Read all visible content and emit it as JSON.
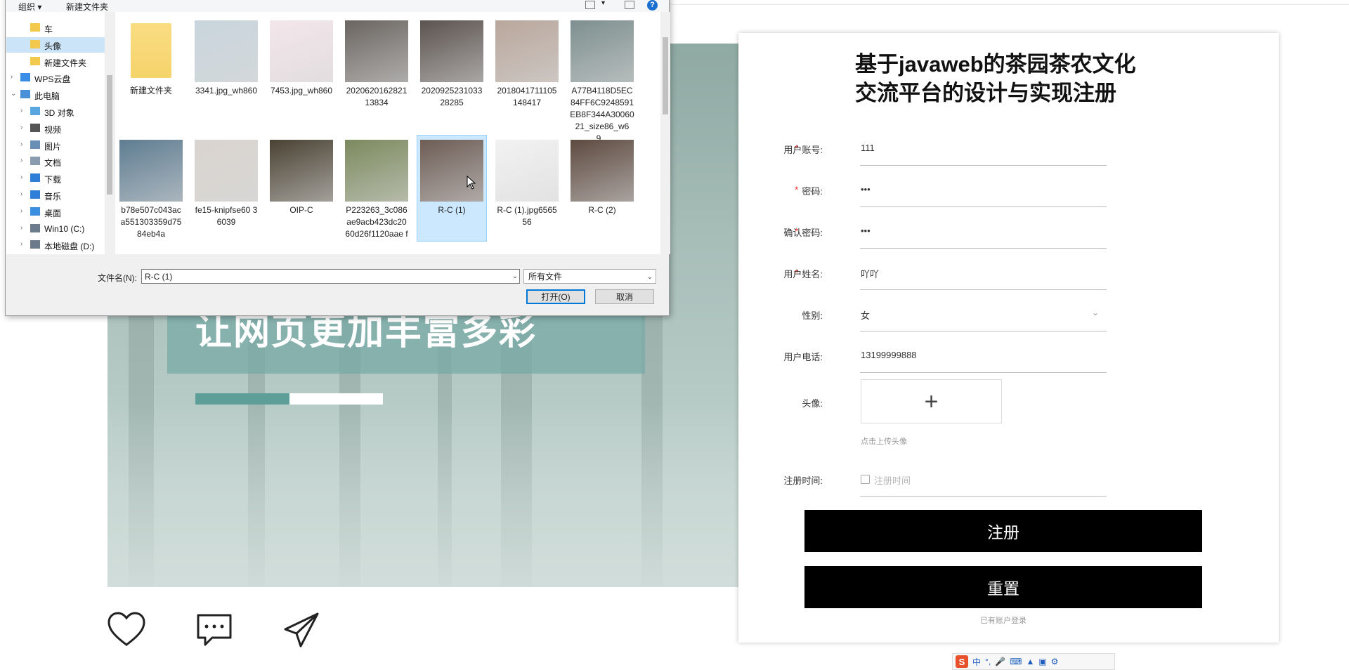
{
  "dialog": {
    "toolbar": {
      "organize": "组织 ▾",
      "new_folder": "新建文件夹"
    },
    "nav": [
      {
        "label": "车",
        "icon": "folder-icon",
        "indent": 1,
        "selected": false
      },
      {
        "label": "头像",
        "icon": "folder-icon",
        "indent": 1,
        "selected": true
      },
      {
        "label": "新建文件夹",
        "icon": "folder-icon",
        "indent": 1,
        "selected": false
      },
      {
        "label": "WPS云盘",
        "icon": "cloud-icon",
        "indent": 0,
        "selected": false
      },
      {
        "label": "此电脑",
        "icon": "computer-icon",
        "indent": 0,
        "selected": false
      },
      {
        "label": "3D 对象",
        "icon": "cube-icon",
        "indent": 1,
        "selected": false
      },
      {
        "label": "视频",
        "icon": "video-icon",
        "indent": 1,
        "selected": false
      },
      {
        "label": "图片",
        "icon": "picture-icon",
        "indent": 1,
        "selected": false
      },
      {
        "label": "文档",
        "icon": "document-icon",
        "indent": 1,
        "selected": false
      },
      {
        "label": "下载",
        "icon": "download-icon",
        "indent": 1,
        "selected": false
      },
      {
        "label": "音乐",
        "icon": "music-icon",
        "indent": 1,
        "selected": false
      },
      {
        "label": "桌面",
        "icon": "desktop-icon",
        "indent": 1,
        "selected": false
      },
      {
        "label": "Win10 (C:)",
        "icon": "drive-icon",
        "indent": 1,
        "selected": false
      },
      {
        "label": "本地磁盘 (D:)",
        "icon": "drive-icon",
        "indent": 1,
        "selected": false
      }
    ],
    "files": [
      {
        "name": "新建文件夹",
        "kind": "folder",
        "color": "#f6d36b",
        "selected": false
      },
      {
        "name": "3341.jpg_wh860",
        "kind": "image",
        "color": "#c9d6dd",
        "selected": false
      },
      {
        "name": "7453.jpg_wh860",
        "kind": "image",
        "color": "#f3e6ea",
        "selected": false
      },
      {
        "name": "2020620162821 13834",
        "kind": "image",
        "color": "#6a6561",
        "selected": false
      },
      {
        "name": "2020925231033 28285",
        "kind": "image",
        "color": "#5b534f",
        "selected": false
      },
      {
        "name": "2018041711105 148417",
        "kind": "image",
        "color": "#b9a79c",
        "selected": false
      },
      {
        "name": "A77B4118D5EC 84FF6C9248591 EB8F344A30060 21_size86_w69...",
        "kind": "image",
        "color": "#7e8f8f",
        "selected": false
      },
      {
        "name": "b78e507c043ac a551303359d75 84eb4a",
        "kind": "image",
        "color": "#5f7d92",
        "selected": false
      },
      {
        "name": "fe15-knipfse60 36039",
        "kind": "image",
        "color": "#d9d4cf",
        "selected": false
      },
      {
        "name": "OIP-C",
        "kind": "image",
        "color": "#4a4233",
        "selected": false
      },
      {
        "name": "P223263_3c086 ae9acb423dc20 60d26f1120aae f",
        "kind": "image",
        "color": "#7c8a5e",
        "selected": false
      },
      {
        "name": "R-C (1)",
        "kind": "image",
        "color": "#6d5d55",
        "selected": true
      },
      {
        "name": "R-C (1).jpg656556",
        "kind": "image",
        "color": "#f2f2f2",
        "selected": false
      },
      {
        "name": "R-C (2)",
        "kind": "image",
        "color": "#5d4a40",
        "selected": false
      }
    ],
    "filename_label": "文件名(N):",
    "filename_value": "R-C (1)",
    "filetype_value": "所有文件",
    "open_label": "打开(O)",
    "cancel_label": "取消"
  },
  "hero": {
    "headline": "让网页更加丰富多彩",
    "progress": 0.5
  },
  "register": {
    "title": "基于javaweb的茶园茶农文化交流平台的设计与实现注册",
    "fields": [
      {
        "label": "用户账号:",
        "value": "111",
        "required": true,
        "type": "text"
      },
      {
        "label": "密码:",
        "value": "•••",
        "required": true,
        "type": "password"
      },
      {
        "label": "确认密码:",
        "value": "•••",
        "required": true,
        "type": "password"
      },
      {
        "label": "用户姓名:",
        "value": "吖吖",
        "required": true,
        "type": "text"
      },
      {
        "label": "性别:",
        "value": "女",
        "required": false,
        "type": "select"
      },
      {
        "label": "用户电话:",
        "value": "13199999888",
        "required": false,
        "type": "text"
      }
    ],
    "avatar_label": "头像:",
    "avatar_hint": "点击上传头像",
    "time_label": "注册时间:",
    "time_placeholder": "注册时间",
    "submit_label": "注册",
    "reset_label": "重置",
    "login_link": "已有账户登录"
  },
  "ime": {
    "lang": "中",
    "punct": "°,"
  },
  "colors": {
    "accent_teal": "#5d9e98",
    "button_black": "#000000",
    "required_red": "#e33333",
    "selection_blue": "#cce8ff"
  }
}
